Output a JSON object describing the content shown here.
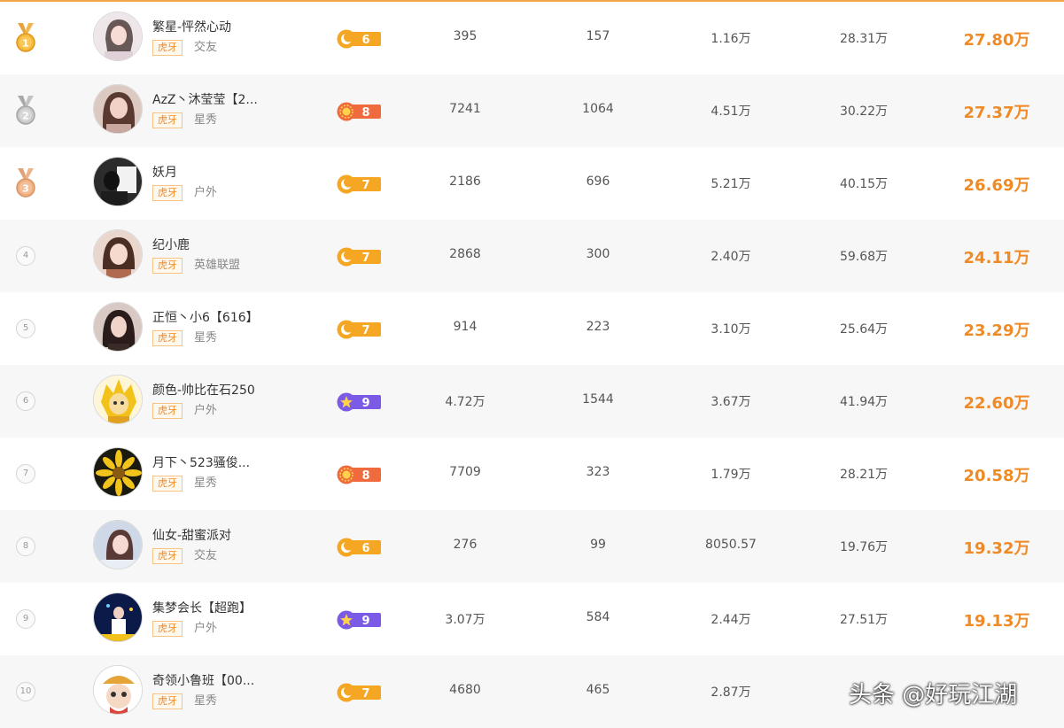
{
  "colors": {
    "accent": "#f08a24",
    "sun": "#ef6b3d",
    "moon": "#f5a623",
    "star": "#7b5be6"
  },
  "platform_tag": "虎牙",
  "rows": [
    {
      "rank": "1",
      "rank_type": "gold",
      "name": "繁星-怦然心动",
      "category": "交友",
      "level": "6",
      "level_icon": "moon-icon",
      "col1": "395",
      "col2": "157",
      "col3": "1.16万",
      "col4": "28.31万",
      "score": "27.80万"
    },
    {
      "rank": "2",
      "rank_type": "silver",
      "name": "AzZ丶沐莹莹【2...",
      "category": "星秀",
      "level": "8",
      "level_icon": "sun-icon",
      "col1": "7241",
      "col2": "1064",
      "col3": "4.51万",
      "col4": "30.22万",
      "score": "27.37万"
    },
    {
      "rank": "3",
      "rank_type": "bronze",
      "name": "妖月",
      "category": "户外",
      "level": "7",
      "level_icon": "moon-icon",
      "col1": "2186",
      "col2": "696",
      "col3": "5.21万",
      "col4": "40.15万",
      "score": "26.69万"
    },
    {
      "rank": "4",
      "rank_type": "plain",
      "name": "纪小鹿",
      "category": "英雄联盟",
      "level": "7",
      "level_icon": "moon-icon",
      "col1": "2868",
      "col2": "300",
      "col3": "2.40万",
      "col4": "59.68万",
      "score": "24.11万"
    },
    {
      "rank": "5",
      "rank_type": "plain",
      "name": "正恒丶小6【616】",
      "category": "星秀",
      "level": "7",
      "level_icon": "moon-icon",
      "col1": "914",
      "col2": "223",
      "col3": "3.10万",
      "col4": "25.64万",
      "score": "23.29万"
    },
    {
      "rank": "6",
      "rank_type": "plain",
      "name": "颜色-帅比在石250",
      "category": "户外",
      "level": "9",
      "level_icon": "star-icon",
      "col1": "4.72万",
      "col2": "1544",
      "col3": "3.67万",
      "col4": "41.94万",
      "score": "22.60万"
    },
    {
      "rank": "7",
      "rank_type": "plain",
      "name": "月下丶523骚俊...",
      "category": "星秀",
      "level": "8",
      "level_icon": "sun-icon",
      "col1": "7709",
      "col2": "323",
      "col3": "1.79万",
      "col4": "28.21万",
      "score": "20.58万"
    },
    {
      "rank": "8",
      "rank_type": "plain",
      "name": "仙女-甜蜜派对",
      "category": "交友",
      "level": "6",
      "level_icon": "moon-icon",
      "col1": "276",
      "col2": "99",
      "col3": "8050.57",
      "col4": "19.76万",
      "score": "19.32万"
    },
    {
      "rank": "9",
      "rank_type": "plain",
      "name": "集梦会长【超跑】",
      "category": "户外",
      "level": "9",
      "level_icon": "star-icon",
      "col1": "3.07万",
      "col2": "584",
      "col3": "2.44万",
      "col4": "27.51万",
      "score": "19.13万"
    },
    {
      "rank": "10",
      "rank_type": "plain",
      "name": "奇领小鲁班【00...",
      "category": "星秀",
      "level": "7",
      "level_icon": "moon-icon",
      "col1": "4680",
      "col2": "465",
      "col3": "2.87万",
      "col4": "",
      "score": ""
    }
  ],
  "watermark": "头条 @好玩江湖"
}
